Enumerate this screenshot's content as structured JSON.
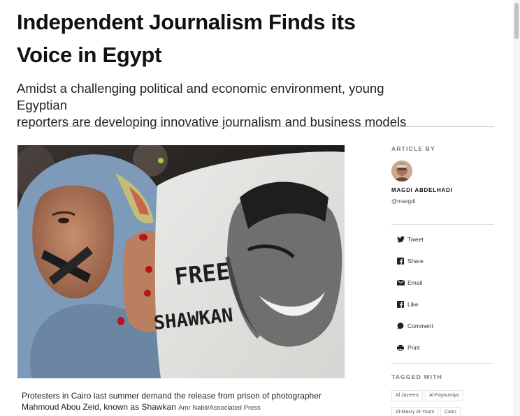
{
  "article": {
    "title_line1": "Independent Journalism Finds its",
    "title_line2": "Voice in Egypt",
    "subtitle_line1": "Amidst a challenging political and economic environment, young Egyptian",
    "subtitle_line2": "reporters are developing innovative journalism and business models"
  },
  "photo": {
    "sign_line1": "FREE",
    "sign_line2": "SHAWKAN",
    "caption_line1": "Protesters in Cairo last summer demand the release from prison of photographer",
    "caption_line2": "Mahmoud Abou Zeid, known as Shawkan",
    "credit": "Amr Nabil/Associated Press"
  },
  "sidebar": {
    "article_by_label": "ARTICLE BY",
    "author_name": "MAGDI ABDELHADI",
    "author_handle": "@maegdi",
    "share": [
      {
        "label": "Tweet",
        "icon": "twitter-icon"
      },
      {
        "label": "Share",
        "icon": "facebook-icon"
      },
      {
        "label": "Email",
        "icon": "email-icon"
      },
      {
        "label": "Like",
        "icon": "facebook-like-icon"
      },
      {
        "label": "Comment",
        "icon": "comment-icon"
      },
      {
        "label": "Print",
        "icon": "print-icon"
      }
    ],
    "tagged_with_label": "TAGGED WITH",
    "tags": [
      "Al Jazeera",
      "Al-Fayoumiya",
      "Al-Masry Al-Youm",
      "Cairo"
    ]
  },
  "colors": {
    "text": "#111111",
    "muted": "#777777",
    "rule": "#c8c8c8"
  }
}
